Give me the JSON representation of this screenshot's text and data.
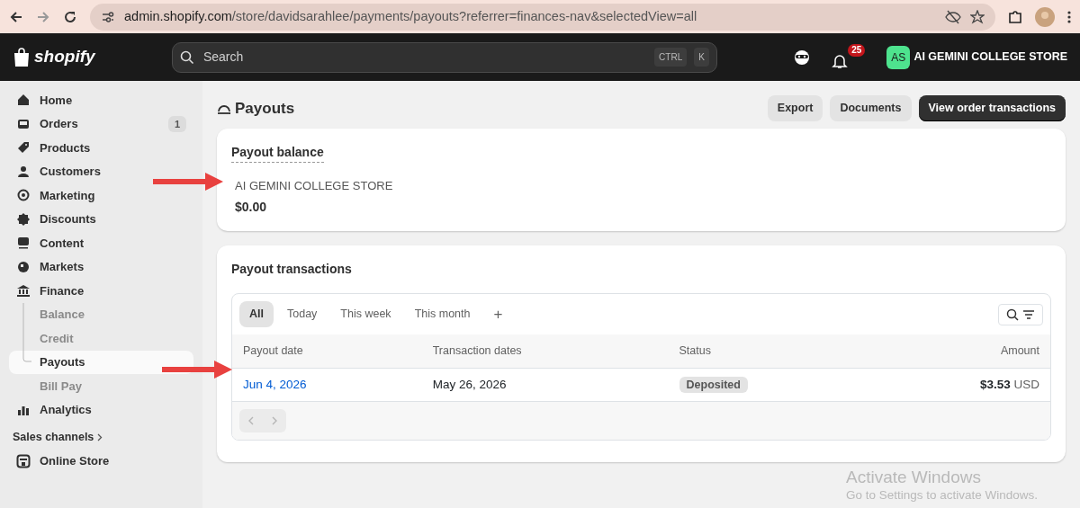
{
  "browser": {
    "url_host": "admin.shopify.com",
    "url_path": "/store/davidsarahlee/payments/payouts?referrer=finances-nav&selectedView=all"
  },
  "topbar": {
    "logo": "shopify",
    "search": {
      "placeholder": "Search"
    },
    "shortcut_keys": [
      "CTRL",
      "K"
    ],
    "notification_count": "25",
    "store_initials": "AS",
    "store_name": "AI GEMINI COLLEGE STORE"
  },
  "sidebar": {
    "items": [
      {
        "label": "Home",
        "selected": false
      },
      {
        "label": "Orders",
        "selected": false,
        "badge": "1"
      },
      {
        "label": "Products",
        "selected": false
      },
      {
        "label": "Customers",
        "selected": false
      },
      {
        "label": "Marketing",
        "selected": false
      },
      {
        "label": "Discounts",
        "selected": false
      },
      {
        "label": "Content",
        "selected": false
      },
      {
        "label": "Markets",
        "selected": false
      },
      {
        "label": "Finance",
        "selected": false,
        "children": [
          {
            "label": "Balance",
            "selected": false
          },
          {
            "label": "Credit",
            "selected": false
          },
          {
            "label": "Payouts",
            "selected": true
          },
          {
            "label": "Bill Pay",
            "selected": false
          }
        ]
      },
      {
        "label": "Analytics",
        "selected": false
      }
    ],
    "section_title": "Sales channels",
    "channels": [
      {
        "label": "Online Store",
        "selected": false
      }
    ]
  },
  "page": {
    "title": "Payouts",
    "actions": [
      {
        "label": "Export",
        "primary": false
      },
      {
        "label": "Documents",
        "primary": false
      },
      {
        "label": "View order transactions",
        "primary": true
      }
    ],
    "balance_card": {
      "title": "Payout balance",
      "store": "AI GEMINI COLLEGE STORE",
      "amount": "$0.00"
    },
    "transactions_card": {
      "title": "Payout transactions",
      "tabs": [
        {
          "label": "All",
          "selected": true
        },
        {
          "label": "Today",
          "selected": false
        },
        {
          "label": "This week",
          "selected": false
        },
        {
          "label": "This month",
          "selected": false
        }
      ],
      "add_tab": "+",
      "table": {
        "columns": [
          "Payout date",
          "Transaction dates",
          "Status",
          "Amount"
        ],
        "rows": [
          {
            "payout_date": "Jun 4, 2026",
            "transaction_dates": "May 26, 2026",
            "status": "Deposited",
            "amount": "$3.53",
            "currency": "USD"
          }
        ]
      }
    }
  },
  "os_notice": {
    "title": "Activate Windows",
    "text": "Go to Settings to activate Windows."
  }
}
